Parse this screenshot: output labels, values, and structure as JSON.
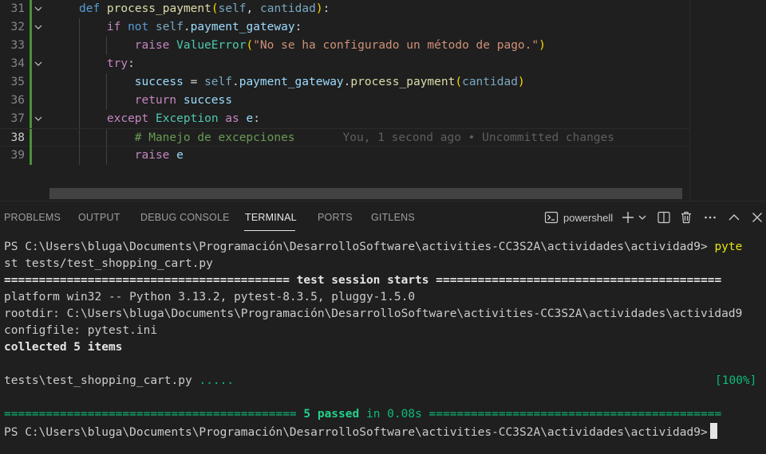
{
  "editor": {
    "lines": [
      {
        "num": "31",
        "parts": [
          [
            "kw",
            "def "
          ],
          [
            "fn",
            "process_payment"
          ],
          [
            "par",
            "("
          ],
          [
            "self",
            "self"
          ],
          [
            "punc",
            ", "
          ],
          [
            "prm",
            "cantidad"
          ],
          [
            "par",
            ")"
          ],
          [
            "punc",
            ":"
          ]
        ]
      },
      {
        "num": "32",
        "parts": [
          [
            "ctrl",
            "if "
          ],
          [
            "kw",
            "not "
          ],
          [
            "self",
            "self"
          ],
          [
            "punc",
            "."
          ],
          [
            "var",
            "payment_gateway"
          ],
          [
            "punc",
            ":"
          ]
        ]
      },
      {
        "num": "33",
        "parts": [
          [
            "ctrl",
            "raise "
          ],
          [
            "cls",
            "ValueError"
          ],
          [
            "par",
            "("
          ],
          [
            "str",
            "\"No se ha configurado un método de pago.\""
          ],
          [
            "par",
            ")"
          ]
        ]
      },
      {
        "num": "34",
        "parts": [
          [
            "ctrl",
            "try"
          ],
          [
            "punc",
            ":"
          ]
        ]
      },
      {
        "num": "35",
        "parts": [
          [
            "var",
            "success"
          ],
          [
            "punc",
            " = "
          ],
          [
            "self",
            "self"
          ],
          [
            "punc",
            "."
          ],
          [
            "var",
            "payment_gateway"
          ],
          [
            "punc",
            "."
          ],
          [
            "fn",
            "process_payment"
          ],
          [
            "par",
            "("
          ],
          [
            "prm",
            "cantidad"
          ],
          [
            "par",
            ")"
          ]
        ]
      },
      {
        "num": "36",
        "parts": [
          [
            "ctrl",
            "return "
          ],
          [
            "var",
            "success"
          ]
        ]
      },
      {
        "num": "37",
        "parts": [
          [
            "ctrl",
            "except "
          ],
          [
            "cls",
            "Exception"
          ],
          [
            "ctrl",
            " as "
          ],
          [
            "var",
            "e"
          ],
          [
            "punc",
            ":"
          ]
        ]
      },
      {
        "num": "38",
        "parts": [
          [
            "cmt",
            "# Manejo de excepciones"
          ]
        ]
      },
      {
        "num": "39",
        "parts": [
          [
            "ctrl",
            "raise "
          ],
          [
            "var",
            "e"
          ]
        ]
      }
    ],
    "blame": "You, 1 second ago • Uncommitted changes"
  },
  "panel": {
    "tabs": [
      "PROBLEMS",
      "OUTPUT",
      "DEBUG CONSOLE",
      "TERMINAL",
      "PORTS",
      "GITLENS"
    ],
    "active_tab": "TERMINAL",
    "shell_label": "powershell",
    "icons": [
      "terminal-icon",
      "add-icon",
      "chevron-down-icon",
      "split-icon",
      "trash-icon",
      "more-icon",
      "maximize-icon",
      "close-icon"
    ]
  },
  "terminal": {
    "prompt_1": "PS C:\\Users\\bluga\\Documents\\Programación\\DesarrolloSoftware\\activities-CC3S2A\\actividades\\actividad9> ",
    "command_1": "pyte",
    "command_2": "st tests/test_shopping_cart.py",
    "session_rule_left": "========================================= ",
    "session_title": "test session starts",
    "session_rule_right": " =========================================",
    "platform_line": "platform win32 -- Python 3.13.2, pytest-8.3.5, pluggy-1.5.0",
    "rootdir_line": "rootdir: C:\\Users\\bluga\\Documents\\Programación\\DesarrolloSoftware\\activities-CC3S2A\\actividades\\actividad9",
    "configfile_line": "configfile: pytest.ini",
    "collected_line": "collected 5 items",
    "test_file": "tests\\test_shopping_cart.py ",
    "test_dots": ".....",
    "test_percent": "[100%]",
    "result_rule_left": "========================================== ",
    "result_passed": "5 passed",
    "result_time": " in 0.08s ",
    "result_rule_right": "==========================================",
    "prompt_2": "PS C:\\Users\\bluga\\Documents\\Programación\\DesarrolloSoftware\\activities-CC3S2A\\actividades\\actividad9>"
  }
}
